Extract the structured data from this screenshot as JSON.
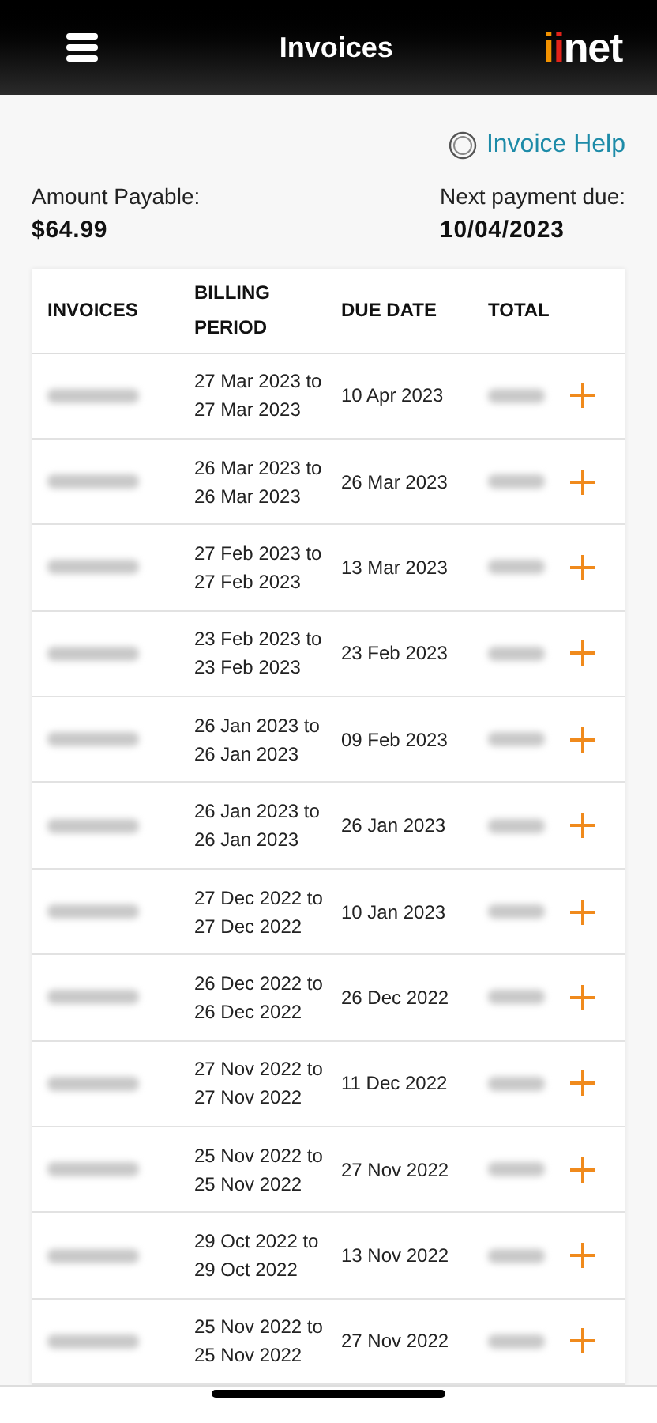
{
  "header": {
    "title": "Invoices",
    "logo_parts": [
      {
        "text": "i",
        "color": "#f39200"
      },
      {
        "text": "i",
        "color": "#e2231a"
      },
      {
        "text": "net",
        "color": "#ffffff"
      }
    ]
  },
  "help_link": "Invoice Help",
  "summary": {
    "amount_label": "Amount Payable:",
    "amount": "$64.99",
    "due_label": "Next payment due:",
    "due": "10/04/2023"
  },
  "table": {
    "columns": [
      "INVOICES",
      "BILLING PERIOD",
      "DUE DATE",
      "TOTAL"
    ],
    "rows": [
      {
        "period": "27 Mar 2023 to 27 Mar 2023",
        "due": "10 Apr 2023"
      },
      {
        "period": "26 Mar 2023 to 26 Mar 2023",
        "due": "26 Mar 2023"
      },
      {
        "period": "27 Feb 2023 to 27 Feb 2023",
        "due": "13 Mar 2023"
      },
      {
        "period": "23 Feb 2023 to 23 Feb 2023",
        "due": "23 Feb 2023"
      },
      {
        "period": "26 Jan 2023 to 26 Jan 2023",
        "due": "09 Feb 2023"
      },
      {
        "period": "26 Jan 2023 to 26 Jan 2023",
        "due": "26 Jan 2023"
      },
      {
        "period": "27 Dec 2022 to 27 Dec 2022",
        "due": "10 Jan 2023"
      },
      {
        "period": "26 Dec 2022 to 26 Dec 2022",
        "due": "26 Dec 2022"
      },
      {
        "period": "27 Nov 2022 to 27 Nov 2022",
        "due": "11 Dec 2022"
      },
      {
        "period": "25 Nov 2022 to 25 Nov 2022",
        "due": "27 Nov 2022"
      },
      {
        "period": "29 Oct 2022 to 29 Oct 2022",
        "due": "13 Nov 2022"
      },
      {
        "period": "25 Nov 2022 to 25 Nov 2022",
        "due": "27 Nov 2022"
      }
    ]
  }
}
